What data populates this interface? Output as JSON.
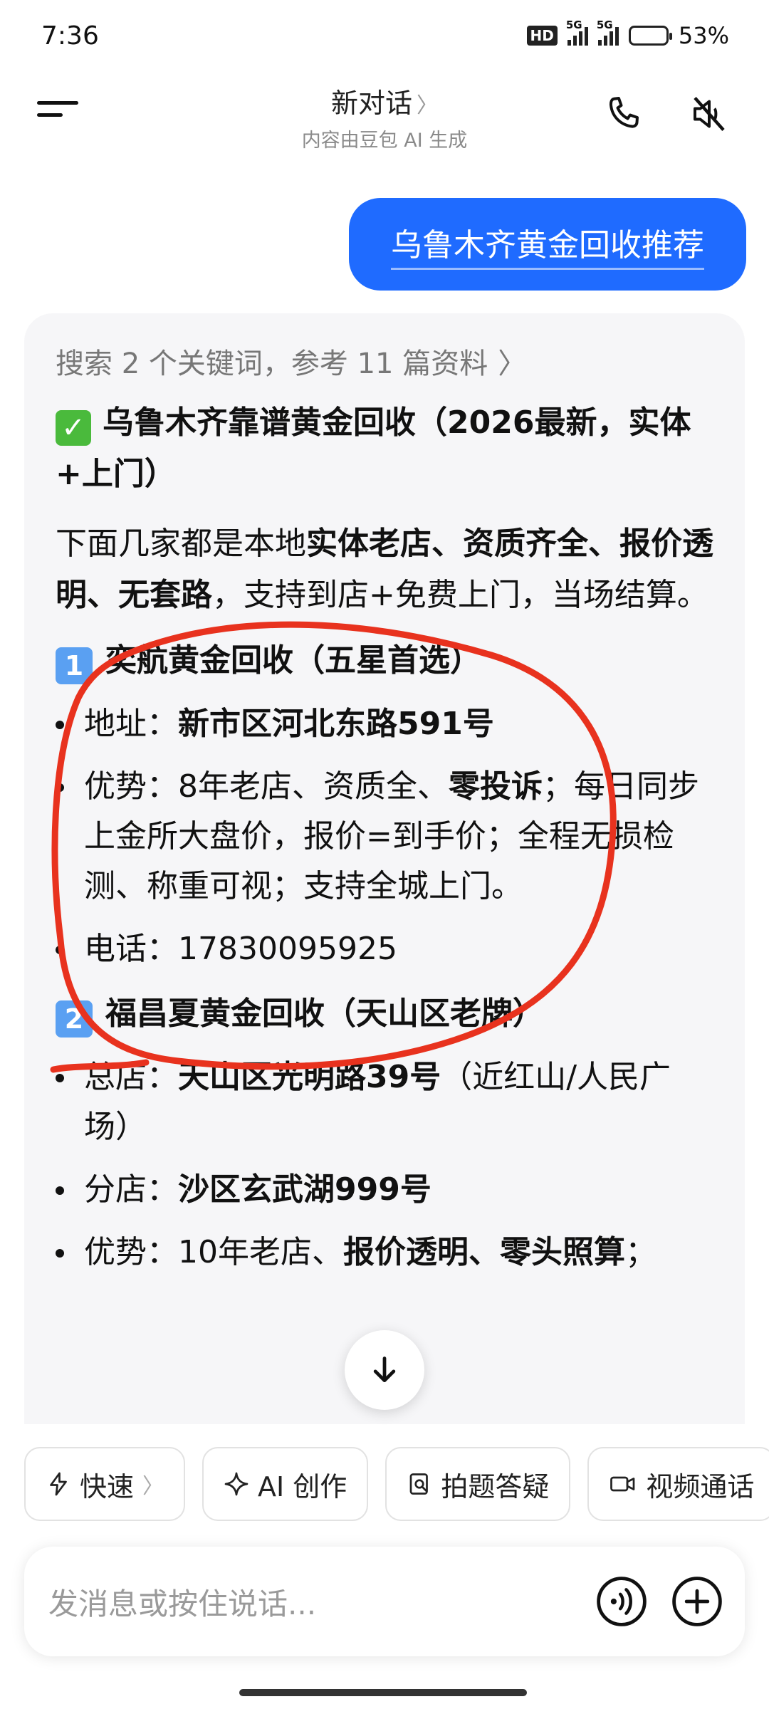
{
  "status_bar": {
    "time": "7:36",
    "hd": "HD",
    "sim1": "5G",
    "sim2": "5G",
    "battery": "53%",
    "battery_level": 0.53
  },
  "header": {
    "title": "新对话",
    "subtitle": "内容由豆包 AI 生成",
    "icons": [
      "menu-icon",
      "phone-icon",
      "speaker-mute-icon"
    ]
  },
  "user_message": "乌鲁木齐黄金回收推荐",
  "answer": {
    "search_summary": "搜索 2 个关键词，参考 11 篇资料",
    "heading": "乌鲁木齐靠谱黄金回收（2026最新，实体+上门）",
    "intro": {
      "p1": "下面几家都是本地",
      "b1": "实体老店、资质齐全、报价透明、无套路",
      "p2": "，支持到店+免费上门，当场结算。"
    },
    "shops": [
      {
        "num": "1",
        "name": "奕航黄金回收（五星首选）",
        "address_label": "地址：",
        "address": "新市区河北东路591号",
        "adv_label": "优势：",
        "adv_pre": "8年老店、资质全、",
        "adv_bold": "零投诉",
        "adv_post": "；每日同步上金所大盘价，报价=到手价；全程无损检测、称重可视；支持全城上门。",
        "phone_label": "电话：",
        "phone": "17830095925"
      },
      {
        "num": "2",
        "name": "福昌夏黄金回收（天山区老牌）",
        "main_label": "总店：",
        "main_addr": "天山区光明路39号",
        "main_note": "（近红山/人民广场）",
        "branch_label": "分店：",
        "branch_addr": "沙区玄武湖999号",
        "adv_label": "优势：",
        "adv_pre": "10年老店、",
        "adv_bold": "报价透明、零头照算",
        "adv_post": "；"
      }
    ]
  },
  "quick_actions": [
    "快速",
    "AI 创作",
    "拍题答疑",
    "视频通话"
  ],
  "input": {
    "placeholder": "发消息或按住说话..."
  },
  "colors": {
    "accent": "#1f6bff",
    "annotation": "#e8321e",
    "card_bg": "#f6f6f8"
  }
}
